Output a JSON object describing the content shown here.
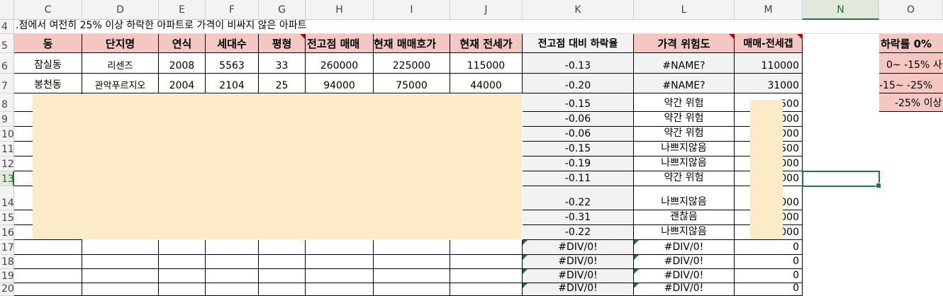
{
  "columns": [
    "C",
    "D",
    "E",
    "F",
    "G",
    "H",
    "I",
    "J",
    "K",
    "L",
    "M",
    "N",
    "O"
  ],
  "selected_column": "N",
  "rows": [
    "4",
    "5",
    "6",
    "7",
    "8",
    "9",
    "10",
    "11",
    "12",
    "13",
    "14",
    "15",
    "16",
    "17",
    "18",
    "19",
    "20"
  ],
  "selected_row": "13",
  "title_row": ".점에서 여전히 25% 이상 하락한 아파트로 가격이 비싸지 않은 아파트",
  "headers": [
    "동",
    "단지명",
    "연식",
    "세대수",
    "평형",
    "전고점 매매",
    "현재 매매호가",
    "현재 전세가",
    "전고점 대비 하락율",
    "가격 위험도",
    "매매-전세갭"
  ],
  "data_rows": [
    [
      "잠실동",
      "리센즈",
      "2008",
      "5563",
      "33",
      "260000",
      "225000",
      "115000",
      "-0.13",
      "#NAME?",
      "110000"
    ],
    [
      "봉천동",
      "관악푸르지오",
      "2004",
      "2104",
      "25",
      "94000",
      "75000",
      "44000",
      "-0.20",
      "#NAME?",
      "31000"
    ]
  ],
  "k_values": [
    "-0.15",
    "-0.06",
    "-0.06",
    "-0.15",
    "-0.19",
    "-0.11",
    "-0.22",
    "-0.31",
    "-0.22",
    "#DIV/0!",
    "#DIV/0!",
    "#DIV/0!",
    "#DIV/0!"
  ],
  "l_values": [
    "약간 위험",
    "약간 위험",
    "약간 위험",
    "나쁘지않음",
    "나쁘지않음",
    "약간 위험",
    "나쁘지않음",
    "괜찮음",
    "나쁘지않음",
    "#DIV/0!",
    "#DIV/0!",
    "#DIV/0!",
    "#DIV/0!"
  ],
  "m_values": [
    "500",
    "000",
    "000",
    "500",
    "000",
    "000",
    "000",
    "000",
    "000",
    "0",
    "0",
    "0",
    "0"
  ],
  "legend": [
    "하락률 0% ",
    "0~ -15% 사",
    "-15~ -25%",
    "-25% 이상"
  ],
  "colors": {
    "header_pink": "#f4c7c3",
    "gray_fill": "#f2f2f2",
    "overlay": "#fdebc8",
    "select_green": "#217346"
  }
}
